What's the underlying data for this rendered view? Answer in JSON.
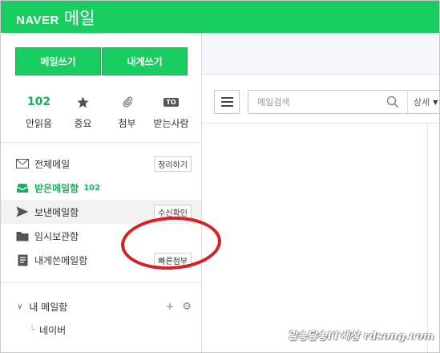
{
  "header": {
    "brand": "NAVER",
    "service": "메일",
    "bg_color": "#19ce60"
  },
  "actions": {
    "write_mail": "메일쓰기",
    "write_to_me": "내게쓰기"
  },
  "quick": [
    {
      "count": "102",
      "label": "안읽음"
    },
    {
      "icon": "star-icon",
      "label": "중요"
    },
    {
      "icon": "paperclip-icon",
      "label": "첨부"
    },
    {
      "badge": "TO",
      "label": "받는사람"
    }
  ],
  "folders": [
    {
      "label": "전체메일",
      "button": "정리하기",
      "icon": "envelope-icon"
    },
    {
      "label": "받은메일함",
      "count": "102",
      "icon": "inbox-icon",
      "active": true
    },
    {
      "label": "보낸메일함",
      "button": "수신확인",
      "icon": "send-icon"
    },
    {
      "label": "임시보관함",
      "icon": "folder-icon"
    },
    {
      "label": "내게쓴메일함",
      "button": "빠른첨부",
      "icon": "document-icon"
    }
  ],
  "my_mailbox": {
    "label": "내 메일함",
    "sub_items": [
      "네이버"
    ]
  },
  "search": {
    "placeholder": "메일검색",
    "detail_label": "상세"
  },
  "watermark": "알송달송IT세상 rdsong.com",
  "accent_color": "#19b25a",
  "annotation_color": "#d81f26"
}
